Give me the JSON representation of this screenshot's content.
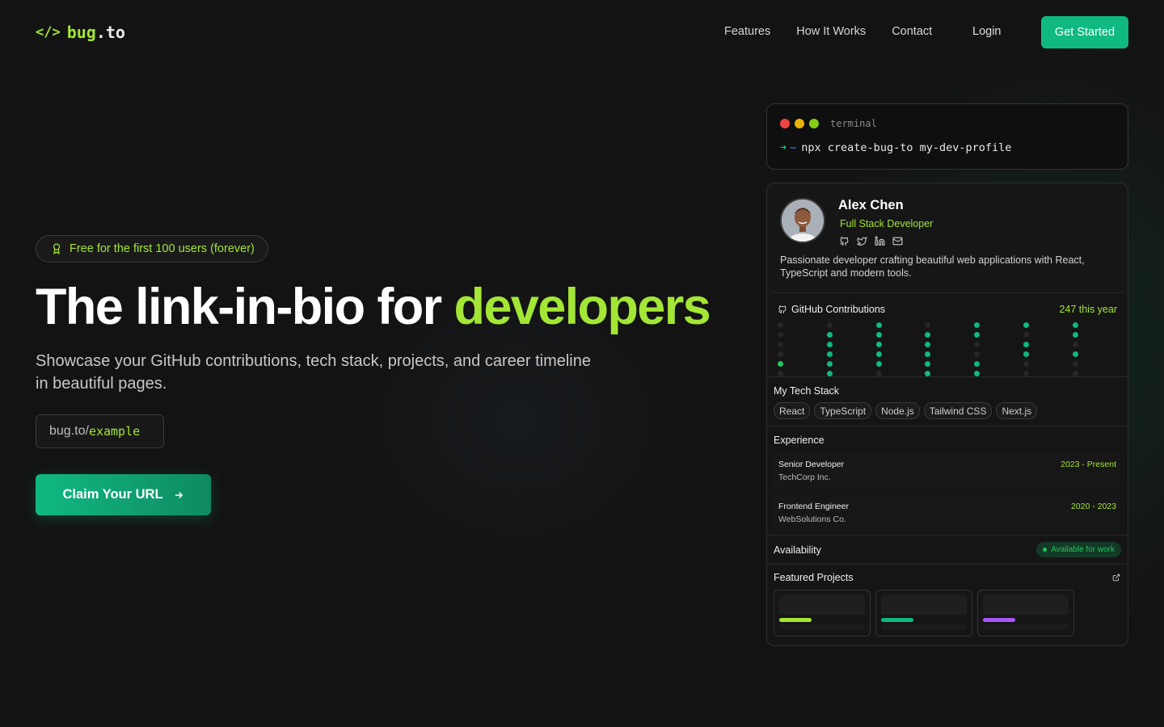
{
  "nav": {
    "logo_part1": "bug",
    "logo_part2": ".to",
    "links": [
      "Features",
      "How It Works",
      "Contact"
    ],
    "login": "Login",
    "cta": "Get Started"
  },
  "hero": {
    "badge": "Free for the first 100 users (forever)",
    "headline_main": "The link-in-bio for ",
    "headline_accent": "developers",
    "subhead": "Showcase your GitHub contributions, tech stack, projects, and career timeline in beautiful pages.",
    "url_prefix": "bug.to/",
    "url_slug": "example",
    "claim_label": "Claim Your URL"
  },
  "terminal": {
    "title": "terminal",
    "prompt_arrow": "➜",
    "prompt_tilde": "~",
    "command": "npx create-bug-to my-dev-profile"
  },
  "profile": {
    "name": "Alex Chen",
    "role": "Full Stack Developer",
    "bio": "Passionate developer crafting beautiful web applications with React, TypeScript and modern tools.",
    "socials": [
      "github-icon",
      "twitter-icon",
      "linkedin-icon",
      "mail-icon"
    ]
  },
  "github": {
    "title": "GitHub Contributions",
    "count": "247 this year",
    "grid": [
      [
        0,
        0,
        0,
        0,
        2,
        0
      ],
      [
        0,
        1,
        1,
        1,
        1,
        1
      ],
      [
        1,
        1,
        1,
        1,
        1,
        0
      ],
      [
        0,
        1,
        1,
        1,
        1,
        1
      ],
      [
        1,
        1,
        0,
        0,
        1,
        1
      ],
      [
        1,
        0,
        1,
        1,
        0,
        0
      ],
      [
        1,
        1,
        0,
        1,
        0,
        0
      ]
    ]
  },
  "stack": {
    "title": "My Tech Stack",
    "tags": [
      "React",
      "TypeScript",
      "Node.js",
      "Tailwind CSS",
      "Next.js"
    ]
  },
  "experience": {
    "title": "Experience",
    "jobs": [
      {
        "title": "Senior Developer",
        "company": "TechCorp Inc.",
        "dates": "2023 - Present"
      },
      {
        "title": "Frontend Engineer",
        "company": "WebSolutions Co.",
        "dates": "2020 - 2023"
      }
    ]
  },
  "availability": {
    "title": "Availability",
    "status": "Available for work"
  },
  "projects": {
    "title": "Featured Projects",
    "accents": [
      "#a3e635",
      "#10b981",
      "#a855f7"
    ]
  },
  "colors": {
    "accent": "#a3e635",
    "primary": "#10b981",
    "background": "#131313"
  }
}
